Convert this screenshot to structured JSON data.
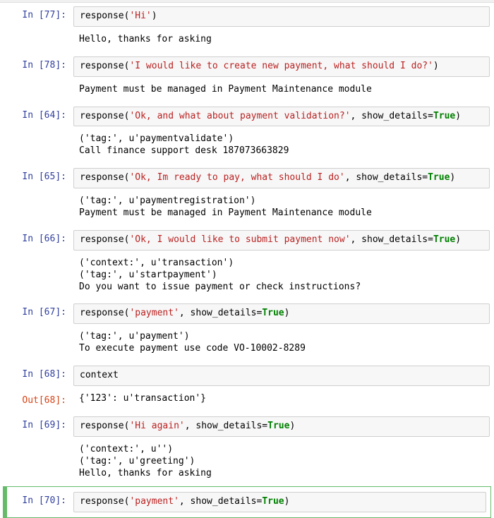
{
  "cells": [
    {
      "type": "code",
      "prompt_label": "In [77]:",
      "tokens": [
        {
          "t": "response(",
          "c": "plain"
        },
        {
          "t": "'Hi'",
          "c": "str"
        },
        {
          "t": ")",
          "c": "plain"
        }
      ],
      "output_lines": [
        "Hello, thanks for asking"
      ]
    },
    {
      "type": "code",
      "prompt_label": "In [78]:",
      "tokens": [
        {
          "t": "response(",
          "c": "plain"
        },
        {
          "t": "'I would like to create new payment, what should I do?'",
          "c": "str"
        },
        {
          "t": ")",
          "c": "plain"
        }
      ],
      "output_lines": [
        "Payment must be managed in Payment Maintenance module"
      ]
    },
    {
      "type": "code",
      "prompt_label": "In [64]:",
      "tokens": [
        {
          "t": "response(",
          "c": "plain"
        },
        {
          "t": "'Ok, and what about payment validation?'",
          "c": "str"
        },
        {
          "t": ", show_details=",
          "c": "plain"
        },
        {
          "t": "True",
          "c": "kw"
        },
        {
          "t": ")",
          "c": "plain"
        }
      ],
      "output_lines": [
        "('tag:', u'paymentvalidate')",
        "Call finance support desk 187073663829"
      ]
    },
    {
      "type": "code",
      "prompt_label": "In [65]:",
      "tokens": [
        {
          "t": "response(",
          "c": "plain"
        },
        {
          "t": "'Ok, Im ready to pay, what should I do'",
          "c": "str"
        },
        {
          "t": ", show_details=",
          "c": "plain"
        },
        {
          "t": "True",
          "c": "kw"
        },
        {
          "t": ")",
          "c": "plain"
        }
      ],
      "output_lines": [
        "('tag:', u'paymentregistration')",
        "Payment must be managed in Payment Maintenance module"
      ]
    },
    {
      "type": "code",
      "prompt_label": "In [66]:",
      "tokens": [
        {
          "t": "response(",
          "c": "plain"
        },
        {
          "t": "'Ok, I would like to submit payment now'",
          "c": "str"
        },
        {
          "t": ", show_details=",
          "c": "plain"
        },
        {
          "t": "True",
          "c": "kw"
        },
        {
          "t": ")",
          "c": "plain"
        }
      ],
      "output_lines": [
        "('context:', u'transaction')",
        "('tag:', u'startpayment')",
        "Do you want to issue payment or check instructions?"
      ]
    },
    {
      "type": "code",
      "prompt_label": "In [67]:",
      "tokens": [
        {
          "t": "response(",
          "c": "plain"
        },
        {
          "t": "'payment'",
          "c": "str"
        },
        {
          "t": ", show_details=",
          "c": "plain"
        },
        {
          "t": "True",
          "c": "kw"
        },
        {
          "t": ")",
          "c": "plain"
        }
      ],
      "output_lines": [
        "('tag:', u'payment')",
        "To execute payment use code VO-10002-8289"
      ]
    },
    {
      "type": "code",
      "prompt_label": "In [68]:",
      "tokens": [
        {
          "t": "context",
          "c": "plain"
        }
      ],
      "result_prompt": "Out[68]:",
      "result_text": "{'123': u'transaction'}"
    },
    {
      "type": "code",
      "prompt_label": "In [69]:",
      "tokens": [
        {
          "t": "response(",
          "c": "plain"
        },
        {
          "t": "'Hi again'",
          "c": "str"
        },
        {
          "t": ", show_details=",
          "c": "plain"
        },
        {
          "t": "True",
          "c": "kw"
        },
        {
          "t": ")",
          "c": "plain"
        }
      ],
      "output_lines": [
        "('context:', u'')",
        "('tag:', u'greeting')",
        "Hello, thanks for asking"
      ]
    },
    {
      "type": "code",
      "prompt_label": "In [70]:",
      "selected": true,
      "tokens": [
        {
          "t": "response(",
          "c": "plain"
        },
        {
          "t": "'payment'",
          "c": "str"
        },
        {
          "t": ", show_details=",
          "c": "plain"
        },
        {
          "t": "True",
          "c": "kw"
        },
        {
          "t": ")",
          "c": "plain"
        }
      ]
    }
  ]
}
